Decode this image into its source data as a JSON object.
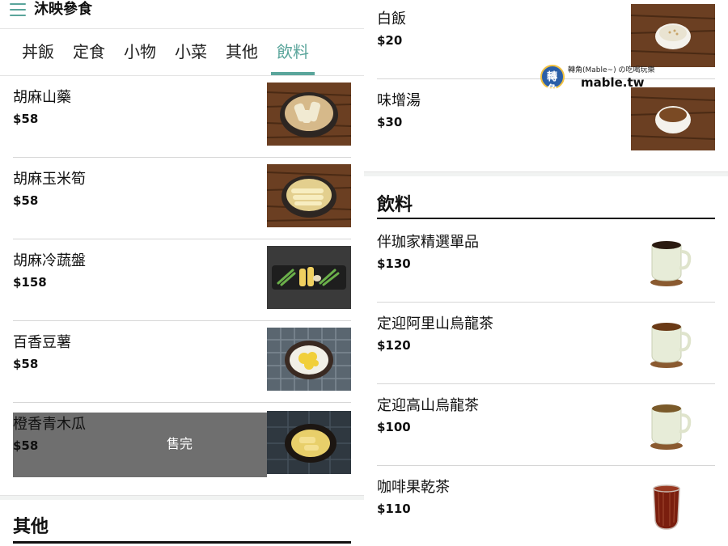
{
  "header": {
    "title": "沐映參食"
  },
  "tabs": [
    {
      "label": "丼飯",
      "active": false
    },
    {
      "label": "定食",
      "active": false
    },
    {
      "label": "小物",
      "active": false
    },
    {
      "label": "小菜",
      "active": false
    },
    {
      "label": "其他",
      "active": false
    },
    {
      "label": "飲料",
      "active": true
    }
  ],
  "accent_color": "#5aa59b",
  "left_items": [
    {
      "name": "胡麻山藥",
      "price": "$58",
      "image": "sesame-yam-dish",
      "sold_out": false
    },
    {
      "name": "胡麻玉米筍",
      "price": "$58",
      "image": "sesame-babycorn-dish",
      "sold_out": false
    },
    {
      "name": "胡麻冷蔬盤",
      "price": "$158",
      "image": "cold-vegetable-plate",
      "sold_out": false
    },
    {
      "name": "百香豆薯",
      "price": "$58",
      "image": "passionfruit-jicama-dish",
      "sold_out": false
    },
    {
      "name": "橙香青木瓜",
      "price": "$58",
      "image": "orange-papaya-dish",
      "sold_out": true
    }
  ],
  "sold_out_label": "售完",
  "left_section": {
    "title": "其他"
  },
  "right_top_items": [
    {
      "name": "白飯",
      "price": "$20",
      "image": "white-rice-bowl"
    },
    {
      "name": "味增湯",
      "price": "$30",
      "image": "miso-soup-bowl"
    }
  ],
  "drinks_section": {
    "title": "飲料"
  },
  "drink_items": [
    {
      "name": "伴珈家精選單品",
      "price": "$130",
      "image": "coffee-cup"
    },
    {
      "name": "定迎阿里山烏龍茶",
      "price": "$120",
      "image": "tea-cup"
    },
    {
      "name": "定迎高山烏龍茶",
      "price": "$100",
      "image": "tea-cup"
    },
    {
      "name": "咖啡果乾茶",
      "price": "$110",
      "image": "glass-of-tea"
    }
  ],
  "watermark": {
    "logo_text": "轉角",
    "caption": "轉角(Mable~) の吃喝玩樂",
    "site": "mable.tw"
  }
}
